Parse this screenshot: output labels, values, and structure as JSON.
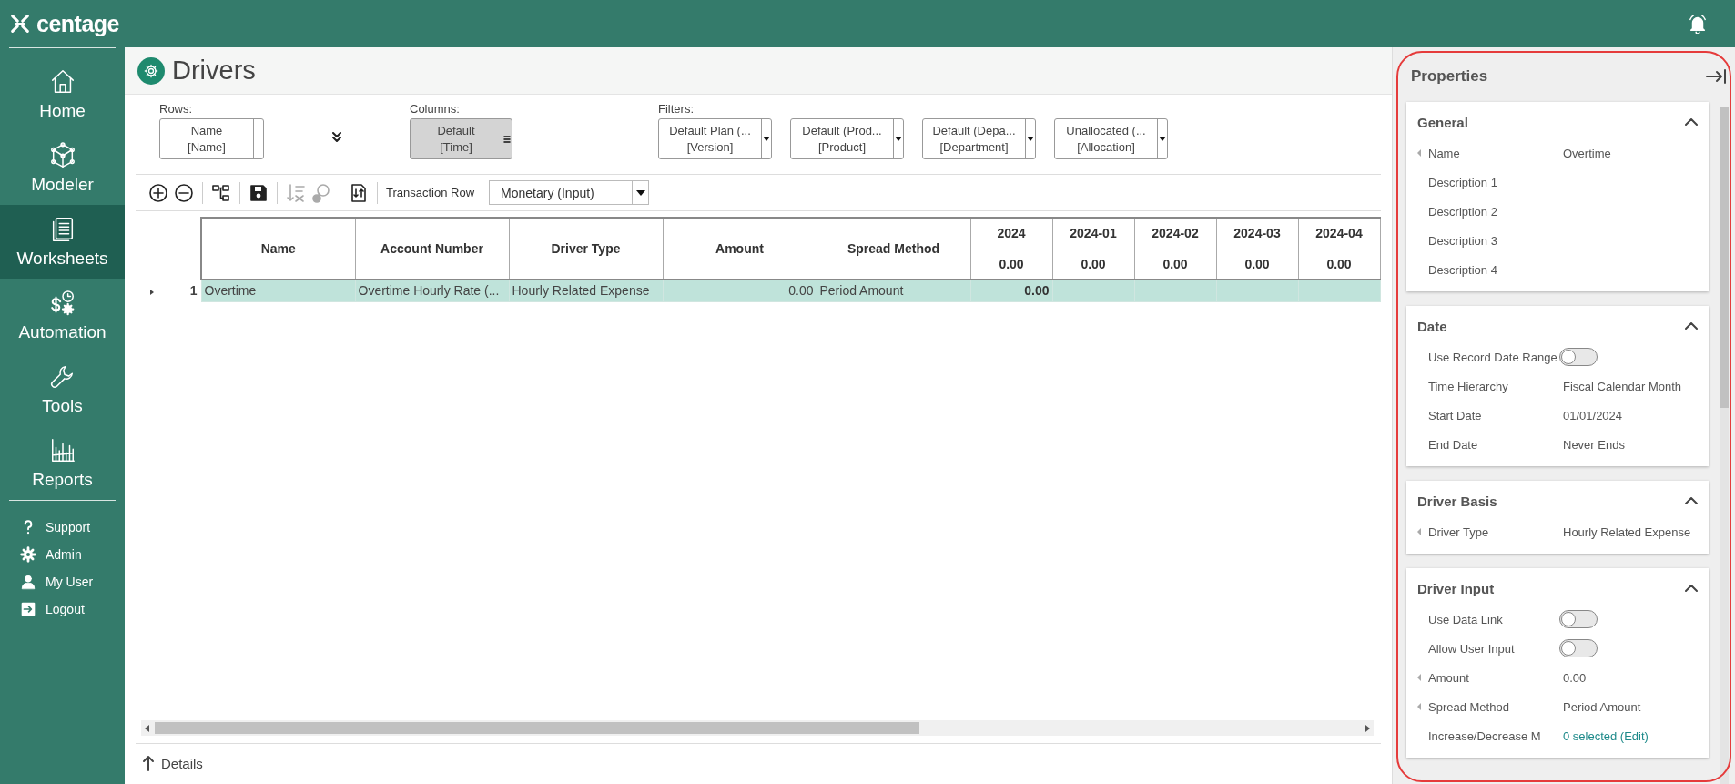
{
  "app": {
    "logo_text": "centage"
  },
  "sidebar": {
    "nav": [
      {
        "label": "Home",
        "selected": false
      },
      {
        "label": "Modeler",
        "selected": false
      },
      {
        "label": "Worksheets",
        "selected": true
      },
      {
        "label": "Automation",
        "selected": false
      },
      {
        "label": "Tools",
        "selected": false
      },
      {
        "label": "Reports",
        "selected": false
      }
    ],
    "links": [
      {
        "label": "Support"
      },
      {
        "label": "Admin"
      },
      {
        "label": "My User"
      },
      {
        "label": "Logout"
      }
    ]
  },
  "page": {
    "title": "Drivers"
  },
  "pivot": {
    "rows": {
      "label": "Rows:",
      "chips": [
        {
          "kind": "plain",
          "line1": "Name",
          "line2": "[Name]",
          "selected": false
        }
      ]
    },
    "columns": {
      "label": "Columns:",
      "chips": [
        {
          "kind": "menu",
          "line1": "Default",
          "line2": "[Time]",
          "selected": true
        }
      ]
    },
    "filters": {
      "label": "Filters:",
      "chips": [
        {
          "kind": "dropdown",
          "line1": "Default Plan (...",
          "line2": "[Version]",
          "selected": false
        },
        {
          "kind": "dropdown",
          "line1": "Default (Prod...",
          "line2": "[Product]",
          "selected": false
        },
        {
          "kind": "dropdown",
          "line1": "Default (Depa...",
          "line2": "[Department]",
          "selected": false
        },
        {
          "kind": "dropdown",
          "line1": "Unallocated (...",
          "line2": "[Allocation]",
          "selected": false
        }
      ]
    }
  },
  "toolbar": {
    "buttons": [
      {
        "kind": "add",
        "disabled": false
      },
      {
        "kind": "remove",
        "disabled": false
      },
      {
        "kind": "hierarchy",
        "disabled": false
      },
      {
        "kind": "save",
        "disabled": false
      },
      {
        "kind": "sort",
        "disabled": true
      },
      {
        "kind": "clear-search",
        "disabled": true
      },
      {
        "kind": "swap",
        "disabled": false
      }
    ],
    "label": "Transaction Row",
    "select_value": "Monetary (Input)"
  },
  "grid": {
    "columns": [
      "Name",
      "Account Number",
      "Driver Type",
      "Amount",
      "Spread Method"
    ],
    "periods": [
      {
        "label": "2024",
        "total": "0.00"
      },
      {
        "label": "2024-01",
        "total": "0.00"
      },
      {
        "label": "2024-02",
        "total": "0.00"
      },
      {
        "label": "2024-03",
        "total": "0.00"
      },
      {
        "label": "2024-04",
        "total": "0.00"
      }
    ],
    "rows": [
      {
        "number": "1",
        "selected": true,
        "expanded": false,
        "cells": [
          "Overtime",
          "Overtime Hourly Rate (...",
          "Hourly Related Expense",
          "0.00",
          "Period Amount"
        ],
        "periods": [
          "0.00"
        ]
      }
    ]
  },
  "details": {
    "label": "Details"
  },
  "properties": {
    "title": "Properties",
    "sections": [
      {
        "title": "General",
        "expanded": true,
        "rows": [
          {
            "kind": "text",
            "label": "Name",
            "value": "Overtime",
            "flagged": true
          },
          {
            "kind": "text",
            "label": "Description 1",
            "flagged": false
          },
          {
            "kind": "text",
            "label": "Description 2",
            "flagged": false
          },
          {
            "kind": "text",
            "label": "Description 3",
            "flagged": false
          },
          {
            "kind": "text",
            "label": "Description 4",
            "flagged": false
          }
        ]
      },
      {
        "title": "Date",
        "expanded": true,
        "rows": [
          {
            "kind": "toggle",
            "label": "Use Record Date Range",
            "on": false,
            "flagged": false
          },
          {
            "kind": "text",
            "label": "Time Hierarchy",
            "value": "Fiscal Calendar Month",
            "flagged": false
          },
          {
            "kind": "text",
            "label": "Start Date",
            "value": "01/01/2024",
            "flagged": false
          },
          {
            "kind": "text",
            "label": "End Date",
            "value": "Never Ends",
            "flagged": false
          }
        ]
      },
      {
        "title": "Driver Basis",
        "expanded": true,
        "rows": [
          {
            "kind": "text",
            "label": "Driver Type",
            "value": "Hourly Related Expense",
            "flagged": true
          }
        ]
      },
      {
        "title": "Driver Input",
        "expanded": true,
        "rows": [
          {
            "kind": "toggle",
            "label": "Use Data Link",
            "on": false,
            "flagged": false
          },
          {
            "kind": "toggle",
            "label": "Allow User Input",
            "on": false,
            "flagged": false
          },
          {
            "kind": "text",
            "label": "Amount",
            "value": "0.00",
            "flagged": true
          },
          {
            "kind": "text",
            "label": "Spread Method",
            "value": "Period Amount",
            "flagged": true
          },
          {
            "kind": "link",
            "label": "Increase/Decrease M",
            "value": "0 selected (Edit)",
            "flagged": false
          }
        ]
      }
    ]
  }
}
